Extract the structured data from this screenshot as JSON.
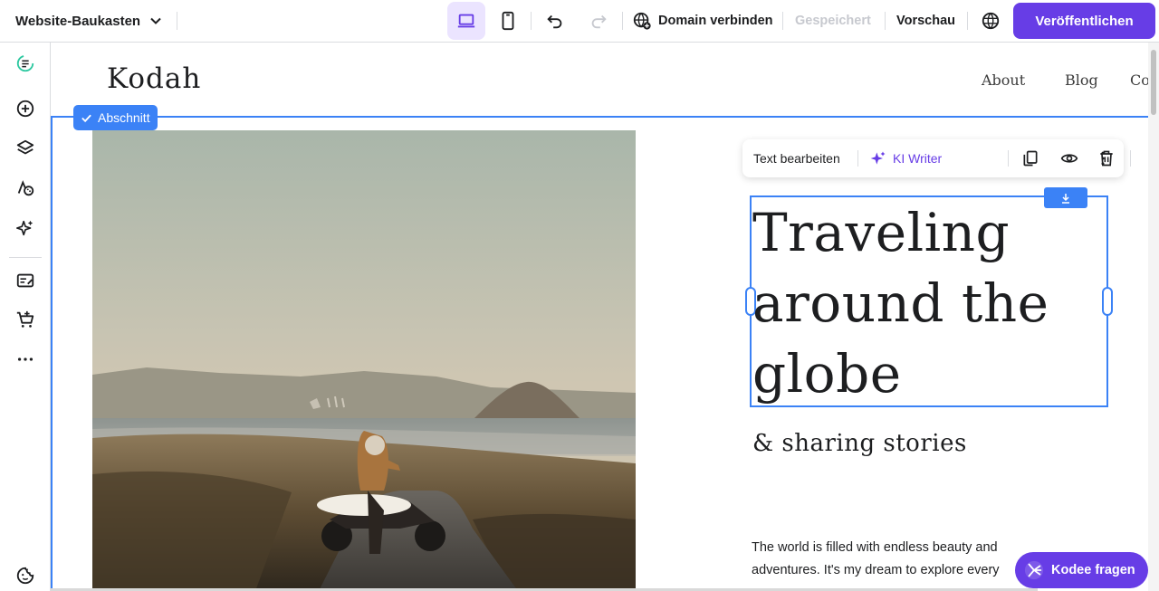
{
  "topbar": {
    "brand": "Website-Baukasten",
    "domain_label": "Domain verbinden",
    "saved_label": "Gespeichert",
    "preview_label": "Vorschau",
    "publish_label": "Veröffentlichen"
  },
  "site": {
    "logo": "Kodah",
    "nav": [
      "About",
      "Blog",
      "Co"
    ]
  },
  "section_badge": "Abschnitt",
  "text_toolbar": {
    "edit_label": "Text bearbeiten",
    "ai_label": "KI Writer"
  },
  "hero": {
    "heading_lines": [
      "Traveling",
      "around the",
      "globe"
    ],
    "subheading": "& sharing stories",
    "body": "The world is filled with endless beauty and adventures. It's my dream to explore every"
  },
  "assistant_label": "Kodee fragen",
  "colors": {
    "accent": "#673de6",
    "selection": "#3b82f6"
  }
}
